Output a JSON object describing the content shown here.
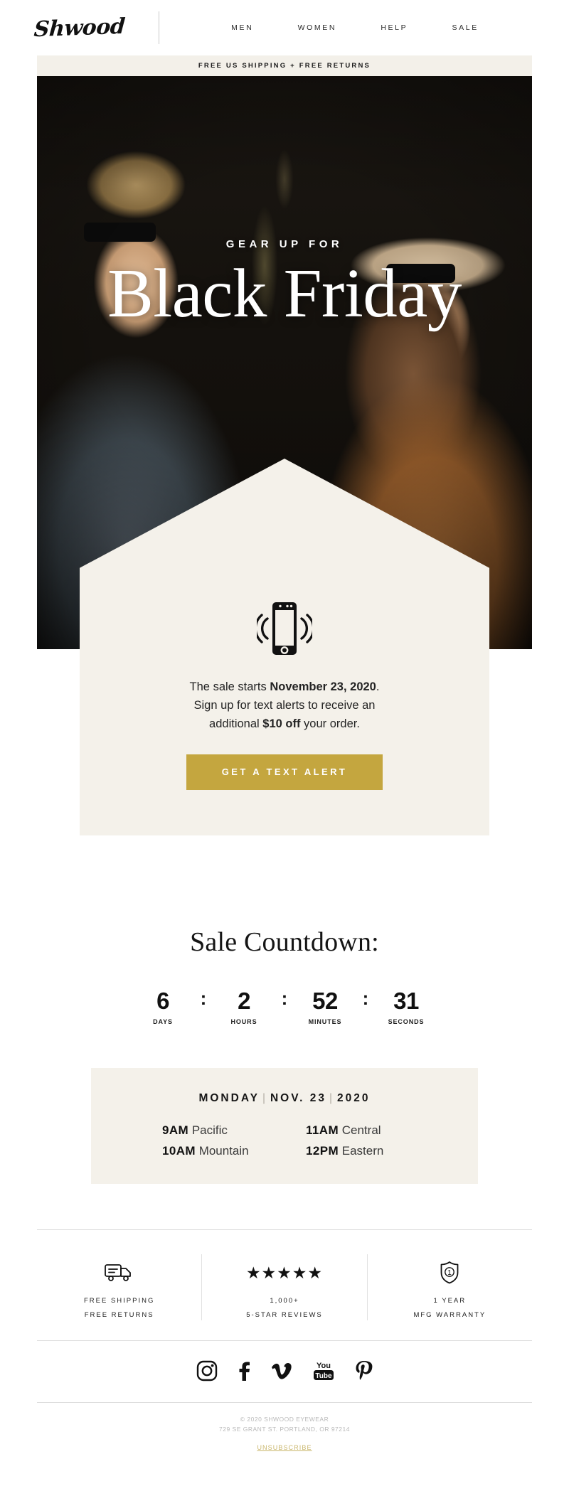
{
  "brand": {
    "logo_text": "Shwood"
  },
  "nav": {
    "items": [
      {
        "label": "MEN",
        "name": "nav-link-men"
      },
      {
        "label": "WOMEN",
        "name": "nav-link-women"
      },
      {
        "label": "HELP",
        "name": "nav-link-help"
      },
      {
        "label": "SALE",
        "name": "nav-link-sale"
      }
    ]
  },
  "banner": {
    "text": "FREE US SHIPPING + FREE RETURNS"
  },
  "hero": {
    "eyebrow": "GEAR UP FOR",
    "title": "Black Friday",
    "photo_alt": "Man and woman wearing sunglasses outdoors"
  },
  "signup": {
    "icon": "vibrating-phone-icon",
    "line1_pre": "The sale starts ",
    "line1_bold": "November 23, 2020",
    "line1_post": ".",
    "line2": "Sign up for text alerts to receive an",
    "line3_pre": "additional ",
    "line3_bold": "$10 off",
    "line3_post": " your order.",
    "cta_label": "GET A TEXT ALERT",
    "cta_color": "#c4a63f"
  },
  "countdown": {
    "title": "Sale Countdown:",
    "separator": ":",
    "units": [
      {
        "value": "6",
        "label": "DAYS"
      },
      {
        "value": "2",
        "label": "HOURS"
      },
      {
        "value": "52",
        "label": "MINUTES"
      },
      {
        "value": "31",
        "label": "SECONDS"
      }
    ]
  },
  "timezones": {
    "heading_day": "MONDAY",
    "heading_date": "NOV. 23",
    "heading_year": "2020",
    "heading_divider": "|",
    "rows": [
      {
        "time": "9AM",
        "zone": "Pacific"
      },
      {
        "time": "11AM",
        "zone": "Central"
      },
      {
        "time": "10AM",
        "zone": "Mountain"
      },
      {
        "time": "12PM",
        "zone": "Eastern"
      }
    ]
  },
  "badges": [
    {
      "icon": "delivery-truck-icon",
      "line1": "FREE SHIPPING",
      "line2": "FREE RETURNS"
    },
    {
      "icon": "five-stars-icon",
      "stars": "★★★★★",
      "line1": "1,000+",
      "line2": "5-STAR REVIEWS"
    },
    {
      "icon": "shield-warranty-icon",
      "shield_number": "1",
      "line1": "1 YEAR",
      "line2": "MFG WARRANTY"
    }
  ],
  "social": [
    {
      "name": "instagram-icon",
      "label": "Instagram"
    },
    {
      "name": "facebook-icon",
      "label": "Facebook"
    },
    {
      "name": "vimeo-icon",
      "label": "Vimeo"
    },
    {
      "name": "youtube-icon",
      "label": "YouTube"
    },
    {
      "name": "pinterest-icon",
      "label": "Pinterest"
    }
  ],
  "footer": {
    "copyright": "© 2020 SHWOOD EYEWEAR",
    "address": "729 SE GRANT ST. PORTLAND, OR 97214",
    "unsubscribe": "UNSUBSCRIBE",
    "unsubscribe_color": "#c9b66b"
  }
}
